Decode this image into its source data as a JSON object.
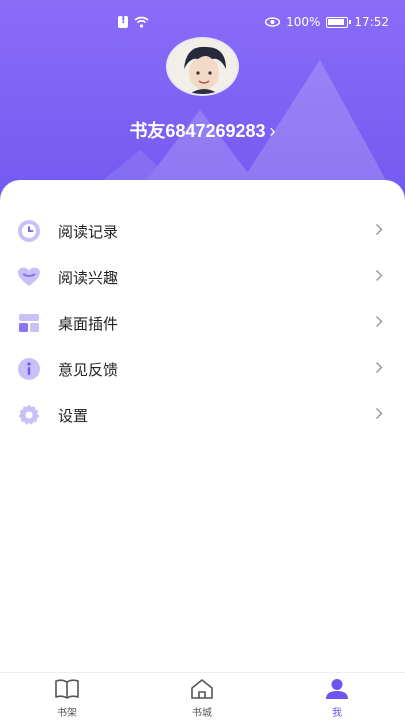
{
  "status_bar": {
    "battery": "100%",
    "time": "17:52"
  },
  "profile": {
    "username": "书友6847269283",
    "chevron": "›"
  },
  "menu": [
    {
      "label": "阅读记录",
      "icon": "clock-icon"
    },
    {
      "label": "阅读兴趣",
      "icon": "heart-icon"
    },
    {
      "label": "桌面插件",
      "icon": "widget-icon"
    },
    {
      "label": "意见反馈",
      "icon": "info-icon"
    },
    {
      "label": "设置",
      "icon": "gear-icon"
    }
  ],
  "tabbar": [
    {
      "label": "书架",
      "icon": "book-icon",
      "active": false
    },
    {
      "label": "书城",
      "icon": "home-icon",
      "active": false
    },
    {
      "label": "我",
      "icon": "person-icon",
      "active": true
    }
  ],
  "colors": {
    "accent": "#6d55ef",
    "header_top": "#8a6cf7",
    "header_bottom": "#7158f0",
    "icon_tint": "#c9c0f7"
  }
}
